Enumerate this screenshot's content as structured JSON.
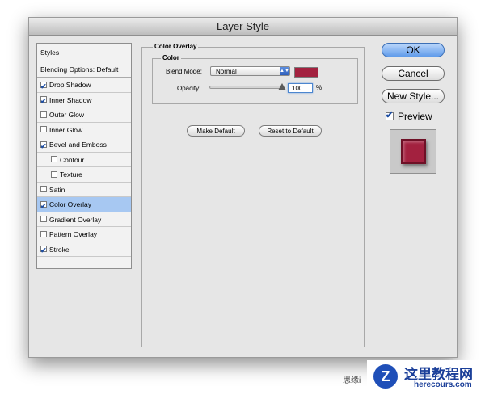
{
  "window": {
    "title": "Layer Style"
  },
  "styles_list": {
    "header": "Styles",
    "blending_options": "Blending Options: Default",
    "items": [
      {
        "label": "Drop Shadow",
        "checked": true,
        "sub": false,
        "selected": false
      },
      {
        "label": "Inner Shadow",
        "checked": true,
        "sub": false,
        "selected": false
      },
      {
        "label": "Outer Glow",
        "checked": false,
        "sub": false,
        "selected": false
      },
      {
        "label": "Inner Glow",
        "checked": false,
        "sub": false,
        "selected": false
      },
      {
        "label": "Bevel and Emboss",
        "checked": true,
        "sub": false,
        "selected": false
      },
      {
        "label": "Contour",
        "checked": false,
        "sub": true,
        "selected": false
      },
      {
        "label": "Texture",
        "checked": false,
        "sub": true,
        "selected": false
      },
      {
        "label": "Satin",
        "checked": false,
        "sub": false,
        "selected": false
      },
      {
        "label": "Color Overlay",
        "checked": true,
        "sub": false,
        "selected": true
      },
      {
        "label": "Gradient Overlay",
        "checked": false,
        "sub": false,
        "selected": false
      },
      {
        "label": "Pattern Overlay",
        "checked": false,
        "sub": false,
        "selected": false
      },
      {
        "label": "Stroke",
        "checked": true,
        "sub": false,
        "selected": false
      }
    ]
  },
  "color_overlay": {
    "section_title": "Color Overlay",
    "group_title": "Color",
    "blend_mode_label": "Blend Mode:",
    "blend_mode_value": "Normal",
    "opacity_label": "Opacity:",
    "opacity_value": "100",
    "opacity_unit": "%",
    "opacity_level": 1.0,
    "overlay_color": "#a3213f",
    "make_default_label": "Make Default",
    "reset_default_label": "Reset to Default"
  },
  "buttons": {
    "ok": "OK",
    "cancel": "Cancel",
    "new_style": "New Style...",
    "preview_label": "Preview",
    "preview_checked": true
  },
  "watermark": {
    "title": "这里教程网",
    "url": "herecours.com",
    "side_text": "思缘i"
  }
}
